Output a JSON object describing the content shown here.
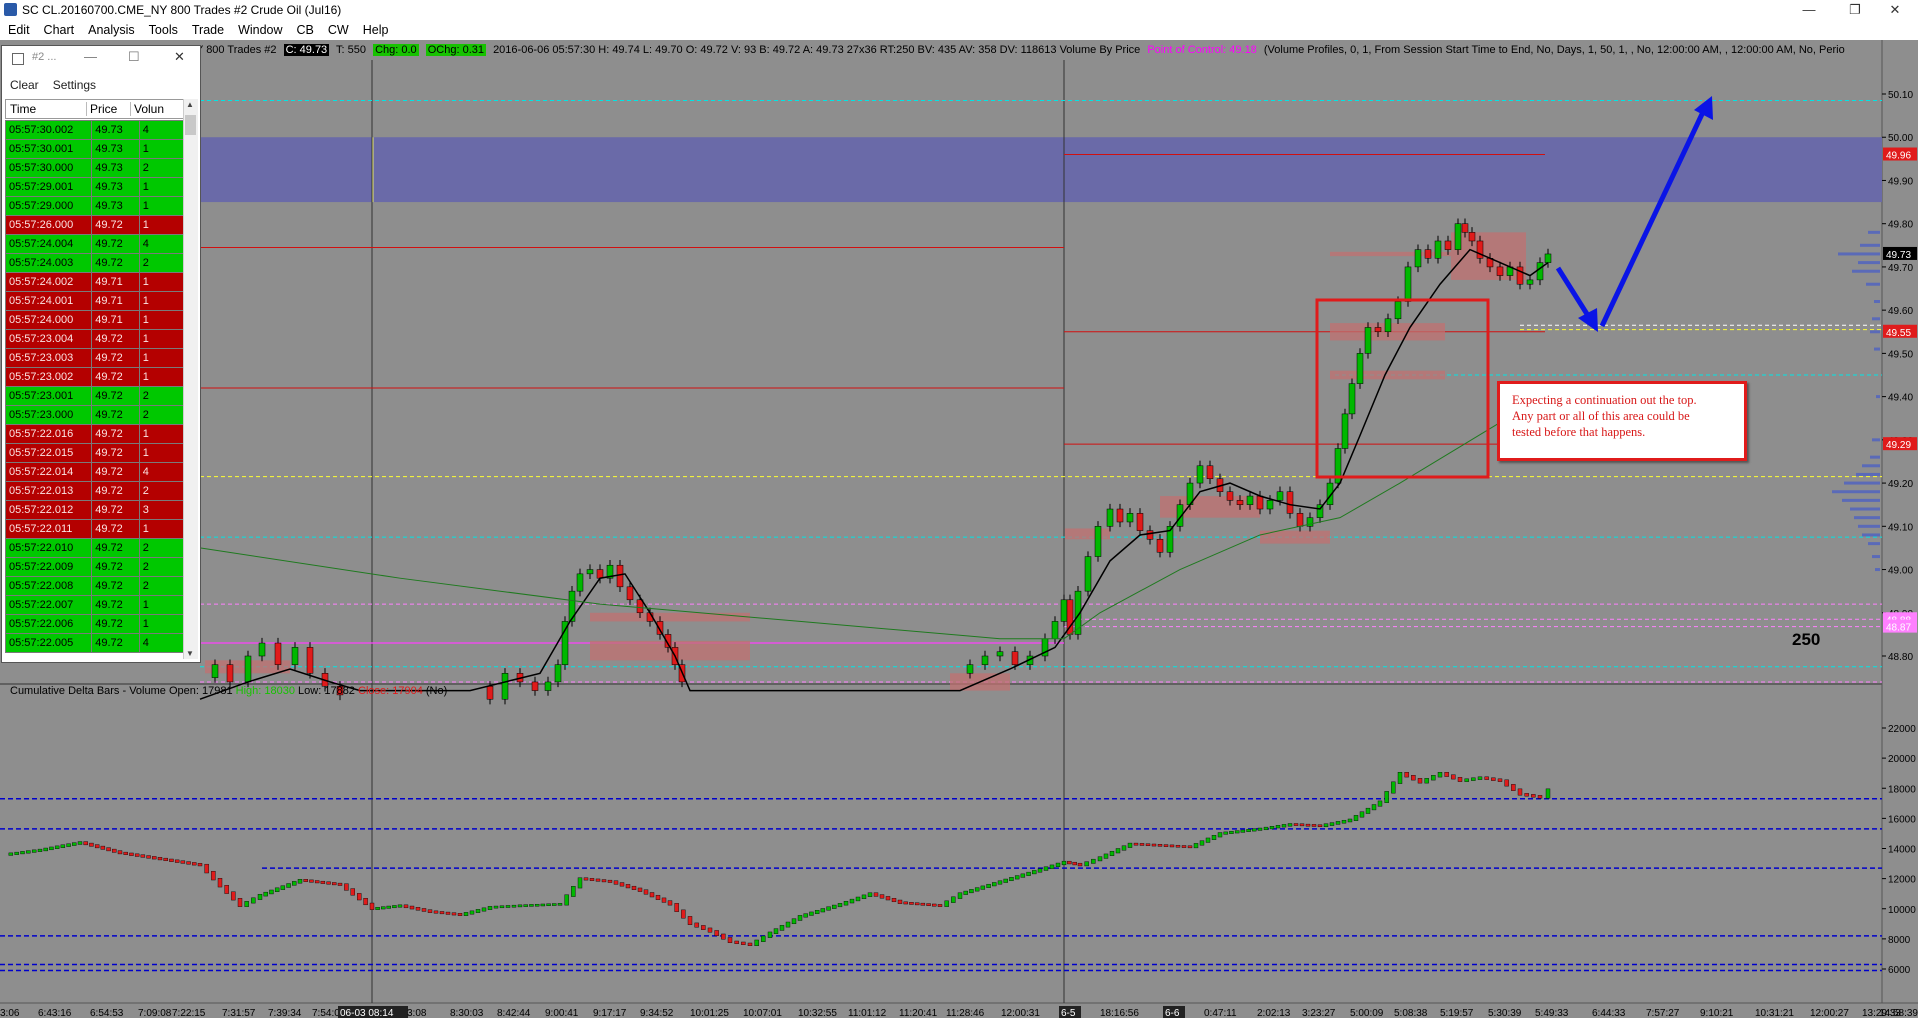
{
  "window": {
    "title": "SC CL.20160700.CME_NY  800 Trades  #2  Crude Oil (Jul16)",
    "minimize": "—",
    "restore": "❐",
    "close": "✕"
  },
  "menu": [
    "Edit",
    "Chart",
    "Analysis",
    "Tools",
    "Trade",
    "Window",
    "CB",
    "CW",
    "Help"
  ],
  "infobar": {
    "prefix": "Y  800 Trades  #2",
    "close_value": "C: 49.73",
    "trades": "T: 550",
    "chg": "Chg: 0.0",
    "ochg": "OChg: 0.31",
    "details": "2016-06-06 05:57:30  H: 49.74  L: 49.70  O: 49.72  V: 93  B: 49.72  A: 49.73  27x36  RT:250  BV: 435  AV: 358  DV: 118613  Volume By Price",
    "poc": "Point of Control: 49.18",
    "study": "(Volume Profiles, 0, 1, From Session Start Time to End, No, Days, 1, 50, 1, , No, 12:00:00 AM, , 12:00:00 AM, No, Perio"
  },
  "time_and_sales": {
    "title": "#2 ...",
    "toolbar": [
      "Clear",
      "Settings"
    ],
    "columns": [
      "Time",
      "Price",
      "Volun"
    ],
    "rows": [
      {
        "time": "05:57:30.002",
        "price": "49.73",
        "vol": "4",
        "side": "buy"
      },
      {
        "time": "05:57:30.001",
        "price": "49.73",
        "vol": "1",
        "side": "buy"
      },
      {
        "time": "05:57:30.000",
        "price": "49.73",
        "vol": "2",
        "side": "buy"
      },
      {
        "time": "05:57:29.001",
        "price": "49.73",
        "vol": "1",
        "side": "buy"
      },
      {
        "time": "05:57:29.000",
        "price": "49.73",
        "vol": "1",
        "side": "buy"
      },
      {
        "time": "05:57:26.000",
        "price": "49.72",
        "vol": "1",
        "side": "sell"
      },
      {
        "time": "05:57:24.004",
        "price": "49.72",
        "vol": "4",
        "side": "buy"
      },
      {
        "time": "05:57:24.003",
        "price": "49.72",
        "vol": "2",
        "side": "buy"
      },
      {
        "time": "05:57:24.002",
        "price": "49.71",
        "vol": "1",
        "side": "sell"
      },
      {
        "time": "05:57:24.001",
        "price": "49.71",
        "vol": "1",
        "side": "sell"
      },
      {
        "time": "05:57:24.000",
        "price": "49.71",
        "vol": "1",
        "side": "sell"
      },
      {
        "time": "05:57:23.004",
        "price": "49.72",
        "vol": "1",
        "side": "sell"
      },
      {
        "time": "05:57:23.003",
        "price": "49.72",
        "vol": "1",
        "side": "sell"
      },
      {
        "time": "05:57:23.002",
        "price": "49.72",
        "vol": "1",
        "side": "sell"
      },
      {
        "time": "05:57:23.001",
        "price": "49.72",
        "vol": "2",
        "side": "buy"
      },
      {
        "time": "05:57:23.000",
        "price": "49.72",
        "vol": "2",
        "side": "buy"
      },
      {
        "time": "05:57:22.016",
        "price": "49.72",
        "vol": "1",
        "side": "sell"
      },
      {
        "time": "05:57:22.015",
        "price": "49.72",
        "vol": "1",
        "side": "sell"
      },
      {
        "time": "05:57:22.014",
        "price": "49.72",
        "vol": "4",
        "side": "sell"
      },
      {
        "time": "05:57:22.013",
        "price": "49.72",
        "vol": "2",
        "side": "sell"
      },
      {
        "time": "05:57:22.012",
        "price": "49.72",
        "vol": "3",
        "side": "sell"
      },
      {
        "time": "05:57:22.011",
        "price": "49.72",
        "vol": "1",
        "side": "sell"
      },
      {
        "time": "05:57:22.010",
        "price": "49.72",
        "vol": "2",
        "side": "buy"
      },
      {
        "time": "05:57:22.009",
        "price": "49.72",
        "vol": "2",
        "side": "buy"
      },
      {
        "time": "05:57:22.008",
        "price": "49.72",
        "vol": "2",
        "side": "buy"
      },
      {
        "time": "05:57:22.007",
        "price": "49.72",
        "vol": "1",
        "side": "buy"
      },
      {
        "time": "05:57:22.006",
        "price": "49.72",
        "vol": "1",
        "side": "buy"
      },
      {
        "time": "05:57:22.005",
        "price": "49.72",
        "vol": "4",
        "side": "buy"
      }
    ]
  },
  "price_axis": {
    "ticks": [
      "50.10",
      "50.00",
      "49.90",
      "49.80",
      "49.70",
      "49.60",
      "49.50",
      "49.40",
      "49.30",
      "49.20",
      "49.10",
      "49.00",
      "48.90",
      "48.80"
    ],
    "tags": [
      {
        "text": "49.96",
        "price": 49.96,
        "color": "#e01b1b",
        "fg": "#ffffff"
      },
      {
        "text": "49.73",
        "price": 49.73,
        "color": "#000000",
        "fg": "#ffffff"
      },
      {
        "text": "49.55",
        "price": 49.55,
        "color": "#e01b1b",
        "fg": "#ffffff"
      },
      {
        "text": "49.29",
        "price": 49.29,
        "color": "#e01b1b",
        "fg": "#ffffff"
      },
      {
        "text": "48.88",
        "price": 48.885,
        "color": "#ff80ff",
        "fg": "#ffffff"
      },
      {
        "text": "48.87",
        "price": 48.868,
        "color": "#ff80ff",
        "fg": "#ffffff"
      }
    ]
  },
  "annotation": {
    "line1": "Expecting a continuation out the top.",
    "line2": "Any part or all of this area could be",
    "line3": "tested before that happens."
  },
  "bar_count_label": "250",
  "delta_panel": {
    "label_title": "Cumulative Delta Bars - Volume",
    "open": "Open: 17981",
    "high": "High: 18030",
    "low": "Low: 17882",
    "close": "Close: 17904",
    "suffix": "(No)",
    "ticks": [
      "22000",
      "20000",
      "18000",
      "16000",
      "14000",
      "12000",
      "10000",
      "8000",
      "6000"
    ]
  },
  "time_axis": {
    "labels": [
      "3:06",
      "6:43:16",
      "6:54:53",
      "7:09:08",
      "7:22:15",
      "7:31:57",
      "7:39:34",
      "7:54:0",
      "06-03 08:14",
      "3:08",
      "8:30:03",
      "8:42:44",
      "9:00:41",
      "9:17:17",
      "9:34:52",
      "10:01:25",
      "10:07:01",
      "10:32:55",
      "11:01:12",
      "11:20:41",
      "11:28:46",
      "12:00:31",
      "6-5",
      "18:16:56",
      "6-6",
      "0:47:11",
      "2:02:13",
      "3:23:27",
      "5:00:09",
      "5:08:38",
      "5:19:57",
      "5:30:39",
      "5:49:33",
      "6:44:33",
      "7:57:27",
      "9:10:21",
      "10:31:21",
      "12:00:27",
      "13:29:33",
      "14:58:39"
    ]
  },
  "colors": {
    "background": "#8e8e8e",
    "resistance_zone": "#6a6aa8",
    "up_candle": "#00b800",
    "down_candle": "#e01b1b",
    "sma_fast": "#000000",
    "sma_slow": "#1f7a1f",
    "arrow": "#0a14e6",
    "annotation_box": "#e01b1b"
  }
}
